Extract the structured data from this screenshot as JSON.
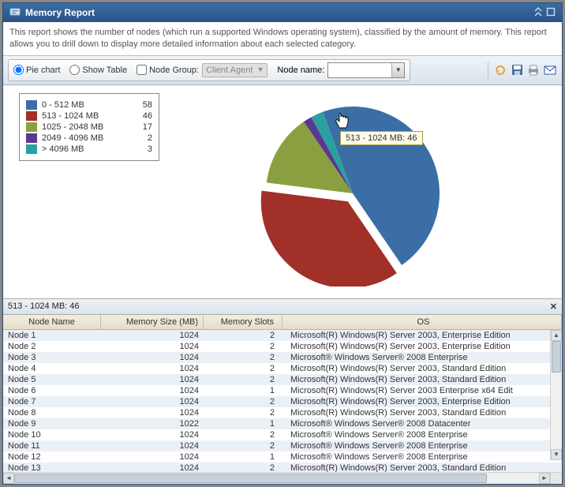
{
  "window": {
    "title": "Memory Report"
  },
  "description": "This report shows the number of nodes (which run a supported Windows operating system), classified by the amount of memory. This report allows you to drill down to display more detailed information about each selected category.",
  "toolbar": {
    "pie_label": "Pie chart",
    "table_label": "Show Table",
    "nodegroup_label": "Node Group:",
    "nodegroup_value": "Client Agent",
    "nodename_label": "Node name:",
    "nodename_value": ""
  },
  "chart_data": {
    "type": "pie",
    "series": [
      {
        "label": "0 - 512 MB",
        "value": 58,
        "color": "#3a6ea5"
      },
      {
        "label": "513 - 1024 MB",
        "value": 46,
        "color": "#a03028",
        "exploded": true
      },
      {
        "label": "1025 - 2048 MB",
        "value": 17,
        "color": "#8aa040"
      },
      {
        "label": "2049 - 4096 MB",
        "value": 2,
        "color": "#5a3890"
      },
      {
        "label": "> 4096 MB",
        "value": 3,
        "color": "#2aa0a0"
      }
    ],
    "tooltip": "513 - 1024 MB: 46"
  },
  "grid": {
    "title": "513 - 1024 MB: 46",
    "columns": [
      "Node Name",
      "Memory Size (MB)",
      "Memory Slots",
      "OS"
    ],
    "rows": [
      {
        "name": "Node 1",
        "mem": 1024,
        "slots": 2,
        "os": "Microsoft(R) Windows(R) Server 2003, Enterprise Edition"
      },
      {
        "name": "Node 2",
        "mem": 1024,
        "slots": 2,
        "os": "Microsoft(R) Windows(R) Server 2003, Enterprise Edition"
      },
      {
        "name": "Node 3",
        "mem": 1024,
        "slots": 2,
        "os": "Microsoft® Windows Server® 2008 Enterprise"
      },
      {
        "name": "Node 4",
        "mem": 1024,
        "slots": 2,
        "os": "Microsoft(R) Windows(R) Server 2003, Standard Edition"
      },
      {
        "name": "Node 5",
        "mem": 1024,
        "slots": 2,
        "os": "Microsoft(R) Windows(R) Server 2003, Standard Edition"
      },
      {
        "name": "Node 6",
        "mem": 1024,
        "slots": 1,
        "os": "Microsoft(R) Windows(R) Server 2003 Enterprise x64 Edit"
      },
      {
        "name": "Node 7",
        "mem": 1024,
        "slots": 2,
        "os": "Microsoft(R) Windows(R) Server 2003, Enterprise Edition"
      },
      {
        "name": "Node 8",
        "mem": 1024,
        "slots": 2,
        "os": "Microsoft(R) Windows(R) Server 2003, Standard Edition"
      },
      {
        "name": "Node 9",
        "mem": 1022,
        "slots": 1,
        "os": "Microsoft® Windows Server® 2008 Datacenter"
      },
      {
        "name": "Node 10",
        "mem": 1024,
        "slots": 2,
        "os": "Microsoft® Windows Server® 2008 Enterprise"
      },
      {
        "name": "Node 11",
        "mem": 1024,
        "slots": 2,
        "os": "Microsoft® Windows Server® 2008 Enterprise"
      },
      {
        "name": "Node 12",
        "mem": 1024,
        "slots": 1,
        "os": "Microsoft® Windows Server® 2008 Enterprise"
      },
      {
        "name": "Node 13",
        "mem": 1024,
        "slots": 2,
        "os": "Microsoft(R) Windows(R) Server 2003, Standard Edition"
      }
    ]
  }
}
